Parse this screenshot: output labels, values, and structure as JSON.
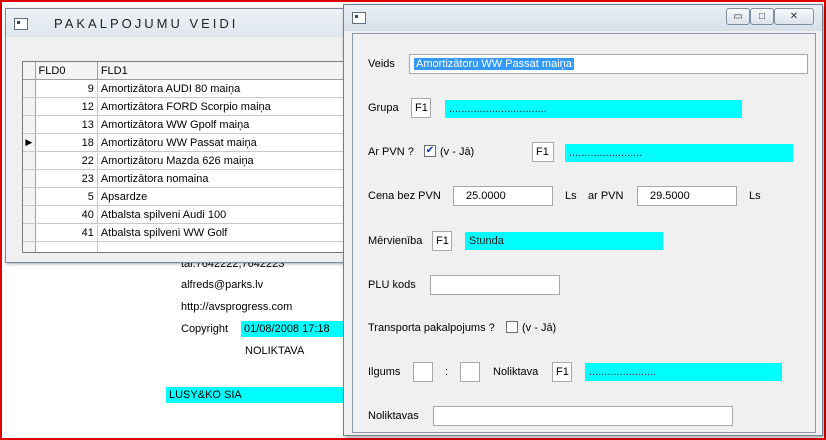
{
  "background": {
    "phone": "tal.7642222,7642223",
    "email": "alfreds@parks.lv",
    "url": "http://avsprogress.com",
    "copyright_label": "Copyright",
    "copyright_date": "01/08/2008 17:18",
    "warehouse": "NOLIKTAVA",
    "company": "LUSY&KO SIA"
  },
  "list_window": {
    "title": "PAKALPOJUMU VEIDI",
    "columns": [
      "FLD0",
      "FLD1"
    ],
    "rows": [
      {
        "id": "9",
        "name": "Amortizātora AUDI 80 maiņa"
      },
      {
        "id": "12",
        "name": "Amortizātora FORD Scorpio maiņa"
      },
      {
        "id": "13",
        "name": "Amortizātora WW Gpolf maiņa"
      },
      {
        "id": "18",
        "name": "Amortizātoru WW Passat maiņa",
        "current": true
      },
      {
        "id": "22",
        "name": "Amortizātoru Mazda 626 maiņa"
      },
      {
        "id": "23",
        "name": "Amortizātora nomaina"
      },
      {
        "id": "5",
        "name": "Apsardze"
      },
      {
        "id": "40",
        "name": "Atbalsta spilveni Audi 100"
      },
      {
        "id": "41",
        "name": "Atbalsta spilveni WW Golf"
      }
    ]
  },
  "edit_window": {
    "buttons": {
      "minimize": "▭",
      "maximize": "□",
      "close": "✕"
    },
    "veids_label": "Veids",
    "veids_value": "Amortizātoru WW Passat maiņa",
    "grupa_label": "Grupa",
    "grupa_key": "F1",
    "grupa_value": "................................",
    "ar_pvn_label": "Ar PVN ?",
    "ar_pvn_checked": true,
    "ar_pvn_hint": "(v - Jā)",
    "ar_pvn_key": "F1",
    "ar_pvn_value": "........................",
    "cena_bez_pvn_label": "Cena bez PVN",
    "cena_bez_pvn_value": "25.0000",
    "currency1": "Ls",
    "ar_pvn_price_label": "ar PVN",
    "ar_pvn_price_value": "29.5000",
    "currency2": "Ls",
    "mervieniba_label": "Mērvienība",
    "mervieniba_key": "F1",
    "mervieniba_value": "Stunda",
    "plu_label": "PLU kods",
    "plu_value": "",
    "transport_label": "Transporta pakalpojums ?",
    "transport_checked": false,
    "transport_hint": "(v - Jā)",
    "ilgums_label": "Ilgums",
    "ilgums_h": "",
    "ilgums_sep": ":",
    "ilgums_m": "",
    "noliktava_label": "Noliktava",
    "noliktava_key": "F1",
    "noliktava_value": "......................",
    "noliktavas_label": "Noliktavas",
    "noliktavas_value": ""
  },
  "colors": {
    "frame": "#e00000",
    "cyan": "#00ffff",
    "selection": "#3399ff"
  }
}
